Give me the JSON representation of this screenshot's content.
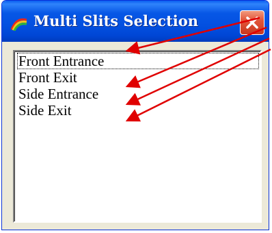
{
  "window": {
    "title": "Multi Slits Selection",
    "app_icon": "rainbow-arc-icon",
    "close_icon": "close-icon"
  },
  "list": {
    "items": [
      {
        "label": "Front Entrance",
        "focused": true
      },
      {
        "label": "Front Exit",
        "focused": false
      },
      {
        "label": "Side Entrance",
        "focused": false
      },
      {
        "label": "Side Exit",
        "focused": false
      }
    ]
  },
  "annotations": {
    "arrow_color": "#e00000",
    "arrow_count": 4
  },
  "colors": {
    "titlebar": "#0350e0",
    "close_button": "#e2563a",
    "window_bg": "#ece9d8"
  }
}
